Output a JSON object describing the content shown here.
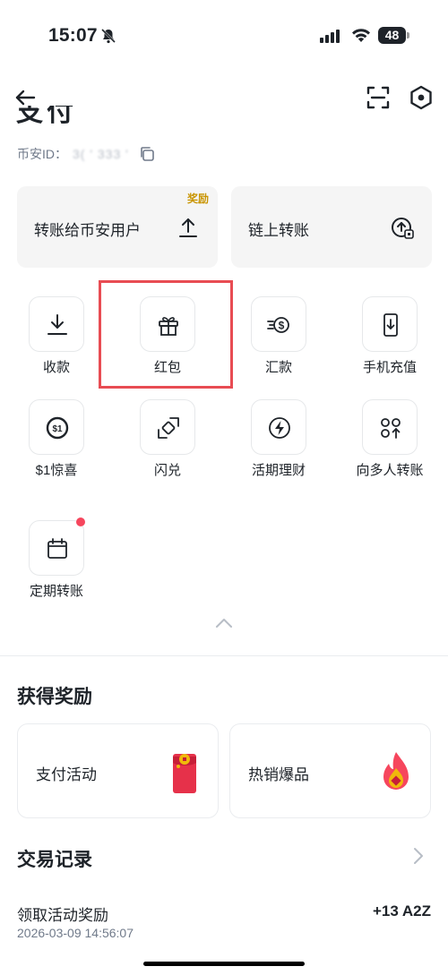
{
  "status_bar": {
    "time": "15:07",
    "battery": "48"
  },
  "header": {
    "title": "支付",
    "uid_label": "币安ID：",
    "uid_value": "3(  ' 333  '"
  },
  "transfer_cards": {
    "binance_user": {
      "label": "转账给币安用户",
      "tag": "奖励"
    },
    "onchain": {
      "label": "链上转账"
    }
  },
  "actions": [
    {
      "label": "收款",
      "icon": "download-icon"
    },
    {
      "label": "红包",
      "icon": "gift-icon"
    },
    {
      "label": "汇款",
      "icon": "remittance-icon"
    },
    {
      "label": "手机充值",
      "icon": "phone-topup-icon"
    },
    {
      "label": "$1惊喜",
      "icon": "dollar-coin-icon"
    },
    {
      "label": "闪兑",
      "icon": "convert-icon"
    },
    {
      "label": "活期理财",
      "icon": "flexible-earn-icon"
    },
    {
      "label": "向多人转账",
      "icon": "batch-transfer-icon"
    },
    {
      "label": "定期转账",
      "icon": "calendar-icon"
    }
  ],
  "rewards": {
    "title": "获得奖励",
    "cards": [
      {
        "label": "支付活动",
        "icon": "red-envelope-icon"
      },
      {
        "label": "热销爆品",
        "icon": "fire-icon"
      }
    ]
  },
  "history": {
    "title": "交易记录",
    "items": [
      {
        "title": "领取活动奖励",
        "amount": "+13 A2Z",
        "time": "2026-03-09 14:56:07"
      }
    ]
  },
  "colors": {
    "accent": "#f0b90b",
    "highlight": "#e84c53",
    "reward_tag": "#c99400"
  }
}
